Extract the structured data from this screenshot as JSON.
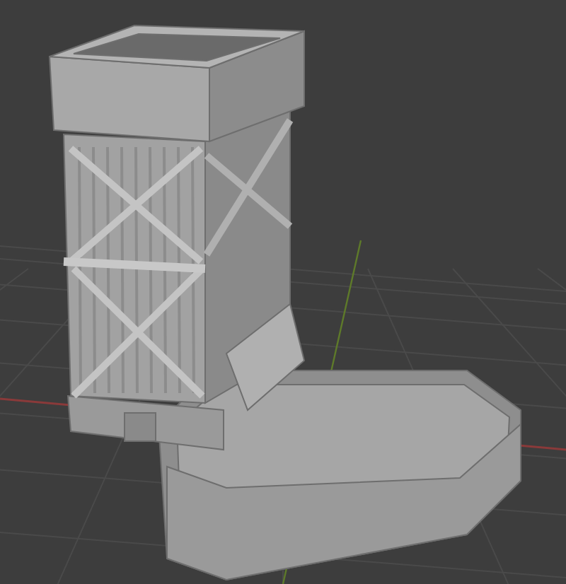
{
  "viewport": {
    "kind": "perspective-grid"
  },
  "model": {
    "kind": "dice-tower"
  }
}
